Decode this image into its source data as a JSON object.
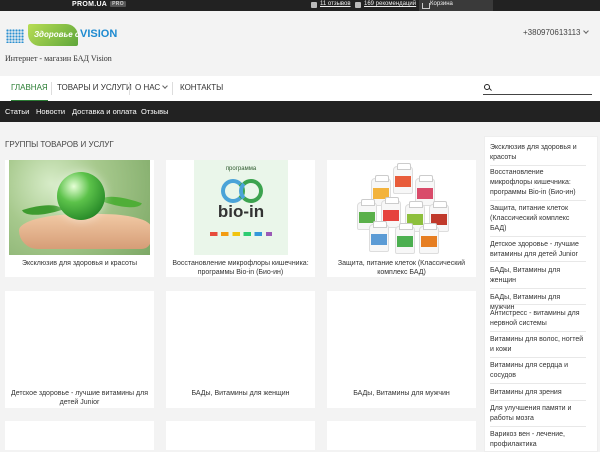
{
  "topbar": {
    "brand": "PROM.UA",
    "pro_badge": "PRO",
    "reviews": "11 отзывов",
    "recommendations": "169 рекомендаций",
    "basket": "Корзина"
  },
  "header": {
    "logo_text_1": "Здоровье с",
    "logo_text_2": "VISION",
    "tagline": "Интернет - магазин БАД Vision",
    "phone": "+380970613113"
  },
  "nav": {
    "items": [
      "ГЛАВНАЯ",
      "ТОВАРЫ И УСЛУГИ",
      "О НАС",
      "КОНТАКТЫ"
    ],
    "search_placeholder": ""
  },
  "subnav": {
    "items": [
      "Статьи",
      "Новости",
      "Доставка и оплата",
      "Отзывы"
    ]
  },
  "main": {
    "section_title": "ГРУППЫ ТОВАРОВ И УСЛУГ",
    "cards": [
      {
        "caption": "Эксклюзив для здоровья и красоты"
      },
      {
        "caption": "Восстановление микрофлоры кишечника: программы Bio-in (Био-ин)",
        "image_label": "программа",
        "image_word": "bio-in"
      },
      {
        "caption": "Защита, питание клеток (Классический комплекс БАД)"
      },
      {
        "caption": "Детское здоровье - лучшие витамины для детей Junior"
      },
      {
        "caption": "БАДы, Витамины для женщин"
      },
      {
        "caption": "БАДы, Витамины для мужчин"
      }
    ]
  },
  "sidebar": {
    "items": [
      "Эксклюзив для здоровья и красоты",
      "Восстановление микрофлоры кишечника: программы Bio-in (Био-ин)",
      "Защита, питание клеток (Классический комплекс БАД)",
      "Детское здоровье - лучшие витамины для детей Junior",
      "БАДы, Витамины для женщин",
      "БАДы, Витамины для мужчин",
      "Антистресс - витамины для нервной системы",
      "Витамины для волос, ногтей и кожи",
      "Витамины для сердца и сосудов",
      "Витамины для зрения",
      "Для улучшения памяти и работы мозга",
      "Варикоз вен - лечение, профилактика"
    ]
  },
  "colors": {
    "accent_green": "#2a7d33",
    "dark_bar": "#222222",
    "logo_blue": "#1d8ad0"
  }
}
